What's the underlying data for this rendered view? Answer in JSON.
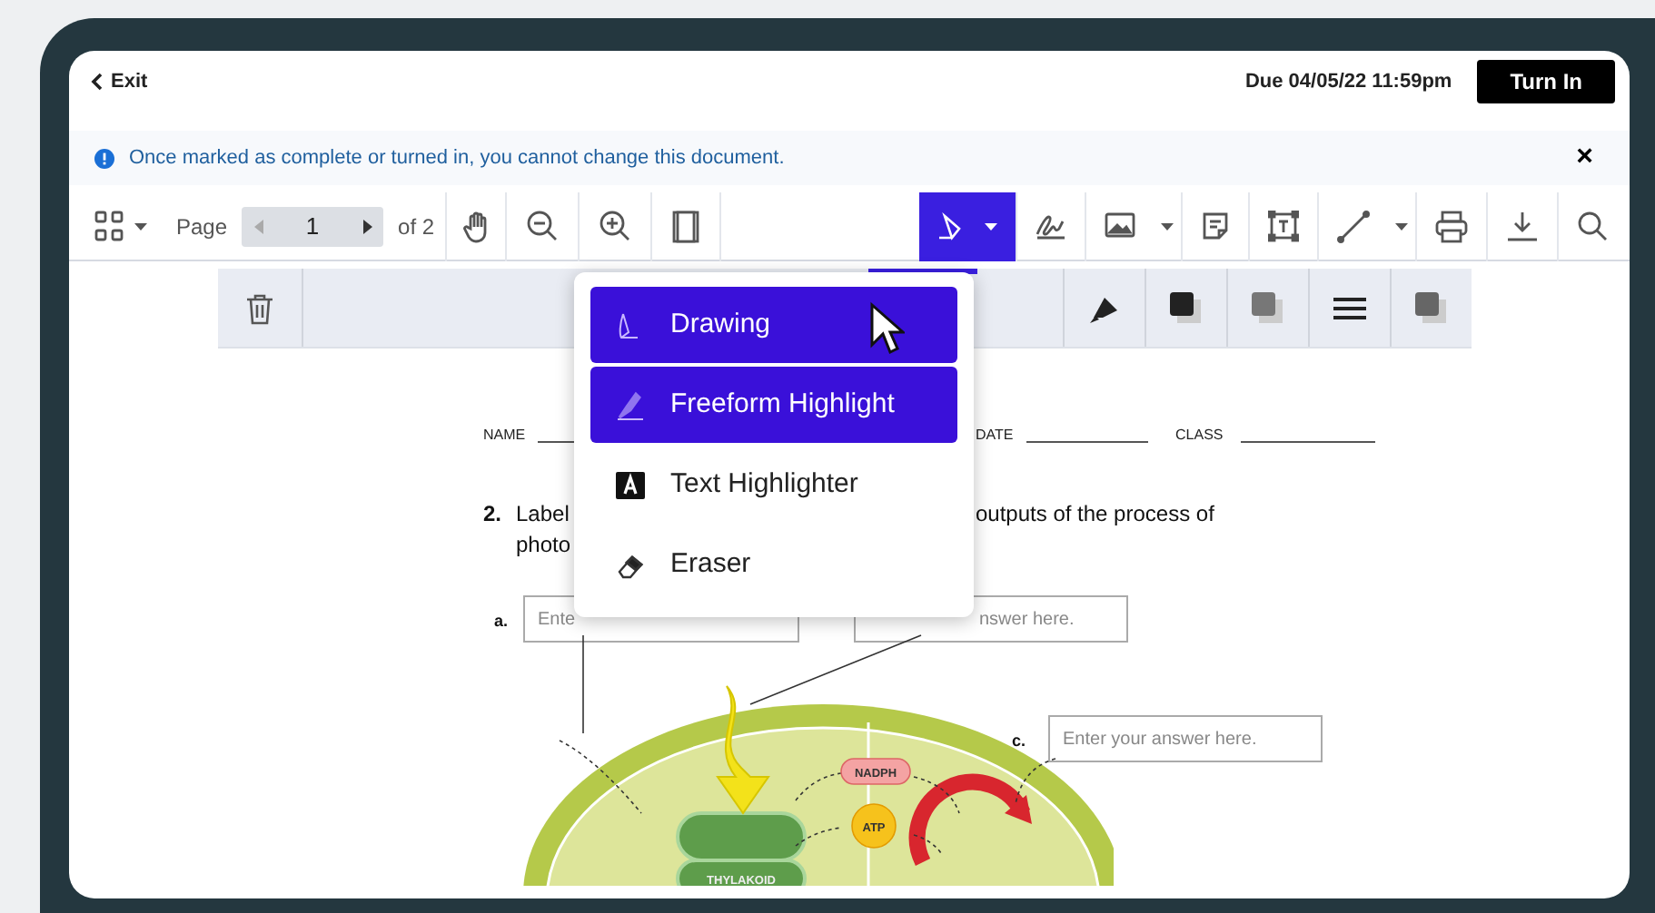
{
  "top_bar": {
    "exit": "Exit",
    "due": "Due 04/05/22 11:59pm",
    "turn_in": "Turn In"
  },
  "notice": {
    "text": "Once marked as complete or turned in, you cannot change this document.",
    "close": "×"
  },
  "toolbar": {
    "page_label": "Page",
    "page_value": "1",
    "page_total": "of 2",
    "pen_selected": true
  },
  "menu": {
    "items": [
      {
        "kind": "drawing",
        "label": "Drawing",
        "selected": true
      },
      {
        "kind": "highlight",
        "label": "Freeform Highlight",
        "selected": true
      },
      {
        "kind": "text",
        "label": "Text Highlighter",
        "selected": false
      },
      {
        "kind": "eraser",
        "label": "Eraser",
        "selected": false
      }
    ]
  },
  "document": {
    "name_label": "NAME",
    "date_label": "DATE",
    "class_label": "CLASS",
    "question_number": "2.",
    "question_parts": [
      "Label",
      "outputs of the process of",
      "photo"
    ],
    "answers": [
      {
        "letter": "a.",
        "placeholder": "Ente"
      },
      {
        "placeholder": "nswer here."
      },
      {
        "letter": "c.",
        "placeholder": "Enter your answer here."
      }
    ],
    "diagram_labels": [
      "NADPH",
      "ATP",
      "THYLAKOID"
    ]
  }
}
